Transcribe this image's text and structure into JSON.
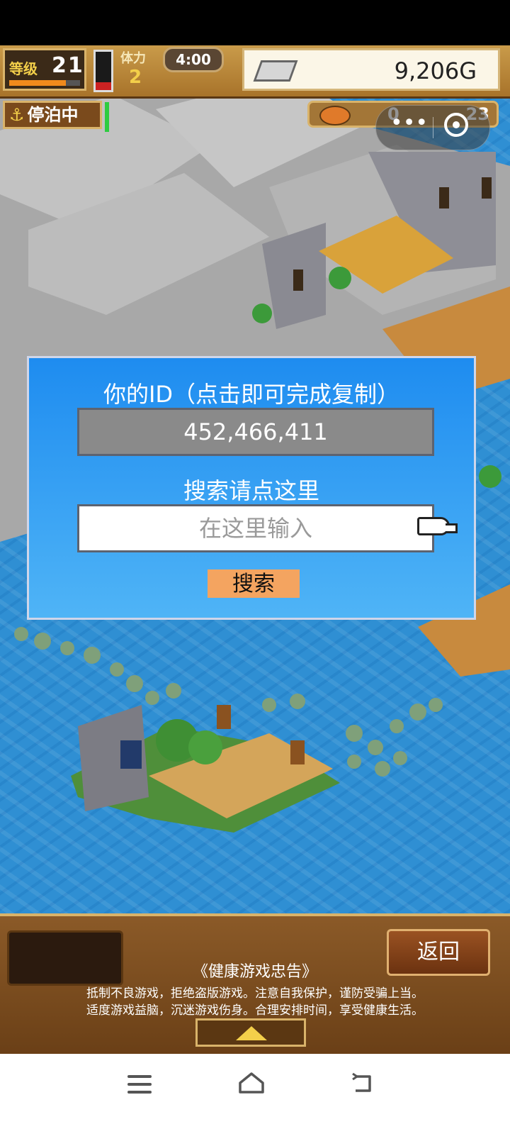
{
  "hud": {
    "level_label": "等级",
    "level_value": "21",
    "level_progress": 0.8,
    "stamina_label": "体力",
    "stamina_value": "2",
    "stamina_fill": 0.2,
    "clock": "4:00",
    "gold": "9,206G",
    "harbor_status": "停泊中",
    "resource_a": "0",
    "resource_b": "23"
  },
  "dialog": {
    "title": "你的ID（点击即可完成复制）",
    "user_id": "452,466,411",
    "search_hint": "搜索请点这里",
    "search_placeholder": "在这里输入",
    "search_button": "搜索"
  },
  "bottom": {
    "back_button": "返回",
    "notice_title": "《健康游戏忠告》",
    "notice_line1": "抵制不良游戏，拒绝盗版游戏。注意自我保护，谨防受骗上当。",
    "notice_line2": "适度游戏益脑，沉迷游戏伤身。合理安排时间，享受健康生活。"
  },
  "colors": {
    "dialog_top": "#1e8cf0",
    "dialog_bottom": "#4fb4f6",
    "search_button": "#f4a460",
    "water": "#2f8fd3"
  }
}
